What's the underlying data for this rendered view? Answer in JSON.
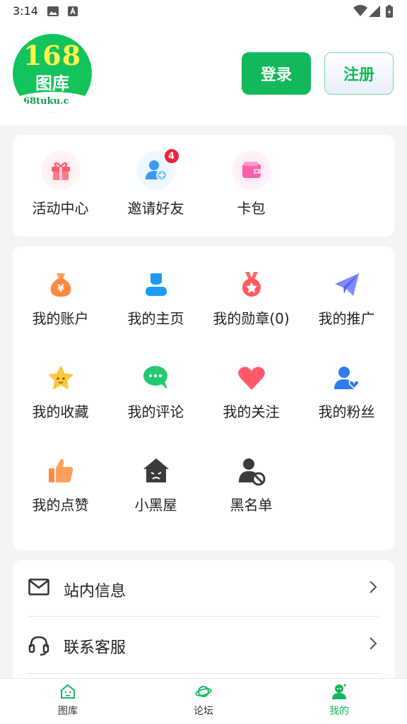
{
  "status_bar": {
    "time": "3:14"
  },
  "logo": {
    "number": "168",
    "text": "图库",
    "url": "168tuku.c"
  },
  "auth": {
    "login_label": "登录",
    "register_label": "注册"
  },
  "quick_actions": [
    {
      "label": "活动中心",
      "icon": "gift-icon"
    },
    {
      "label": "邀请好友",
      "icon": "invite-friend-icon",
      "badge": "4"
    },
    {
      "label": "卡包",
      "icon": "wallet-icon"
    }
  ],
  "menu_grid": [
    {
      "label": "我的账户",
      "icon": "money-bag-icon"
    },
    {
      "label": "我的主页",
      "icon": "user-icon"
    },
    {
      "label": "我的勋章(0)",
      "icon": "medal-icon"
    },
    {
      "label": "我的推广",
      "icon": "paper-plane-icon"
    },
    {
      "label": "我的收藏",
      "icon": "star-icon"
    },
    {
      "label": "我的评论",
      "icon": "comment-icon"
    },
    {
      "label": "我的关注",
      "icon": "heart-icon"
    },
    {
      "label": "我的粉丝",
      "icon": "fans-icon"
    },
    {
      "label": "我的点赞",
      "icon": "thumbs-up-icon"
    },
    {
      "label": "小黑屋",
      "icon": "dark-house-icon"
    },
    {
      "label": "黑名单",
      "icon": "blocked-user-icon"
    }
  ],
  "list": [
    {
      "label": "站内信息",
      "icon": "mail-icon"
    },
    {
      "label": "联系客服",
      "icon": "headset-icon"
    }
  ],
  "tabs": [
    {
      "label": "图库",
      "icon": "gallery-icon",
      "active": false
    },
    {
      "label": "论坛",
      "icon": "planet-icon",
      "active": false
    },
    {
      "label": "我的",
      "icon": "profile-icon",
      "active": true
    }
  ],
  "colors": {
    "accent": "#12b95a",
    "badge": "#f2213b"
  }
}
